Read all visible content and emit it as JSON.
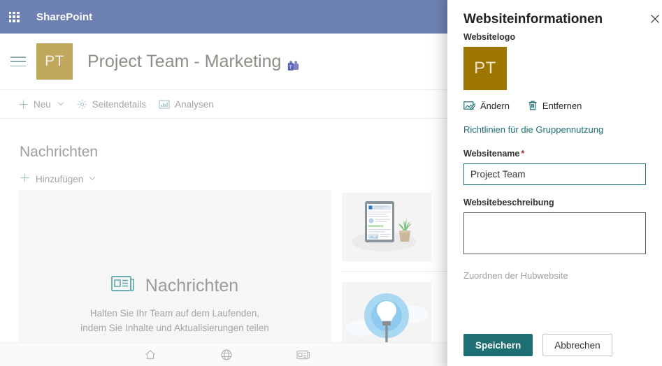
{
  "suite": {
    "waffle_icon": "app-launcher-icon",
    "brand": "SharePoint"
  },
  "site": {
    "hamburger_icon": "hamburger-menu-icon",
    "logo_initials": "PT",
    "title": "Project Team - Marketing",
    "teams_icon": "microsoft-teams-icon",
    "commands": [
      {
        "icon": "plus-icon",
        "label": "Neu",
        "caret": "⌄"
      },
      {
        "icon": "gear-icon",
        "label": "Seitendetails"
      },
      {
        "icon": "analytics-icon",
        "label": "Analysen"
      }
    ],
    "news": {
      "heading": "Nachrichten",
      "add_icon": "plus-icon",
      "add_label": "Hinzufügen",
      "add_caret": "⌄",
      "empty_icon": "news-icon",
      "empty_title": "Nachrichten",
      "empty_text": "Halten Sie Ihr Team auf dem Laufenden, indem Sie Inhalte und Aktualisierungen teilen",
      "thumbnails": [
        {
          "name": "tablet-with-plant-illustration"
        },
        {
          "name": "lightbulb-with-clouds-illustration"
        }
      ]
    },
    "footer_icons": [
      {
        "name": "home-icon"
      },
      {
        "name": "globe-icon"
      },
      {
        "name": "news-icon"
      }
    ]
  },
  "panel": {
    "title": "Websiteinformationen",
    "close_icon": "close-icon",
    "logo": {
      "label": "Websitelogo",
      "initials": "PT",
      "color": "#9c7600",
      "change_icon": "image-edit-icon",
      "change_label": "Ändern",
      "remove_icon": "trash-icon",
      "remove_label": "Entfernen"
    },
    "policy_link": "Richtlinien für die Gruppennutzung",
    "name_field": {
      "label": "Websitename",
      "required_mark": "*",
      "value": "Project Team",
      "placeholder": ""
    },
    "description_field": {
      "label": "Websitebeschreibung",
      "value": "",
      "placeholder": ""
    },
    "hub_link": "Zuordnen der Hubwebsite",
    "save_label": "Speichern",
    "cancel_label": "Abbrechen",
    "accent_color": "#1d6f73"
  }
}
